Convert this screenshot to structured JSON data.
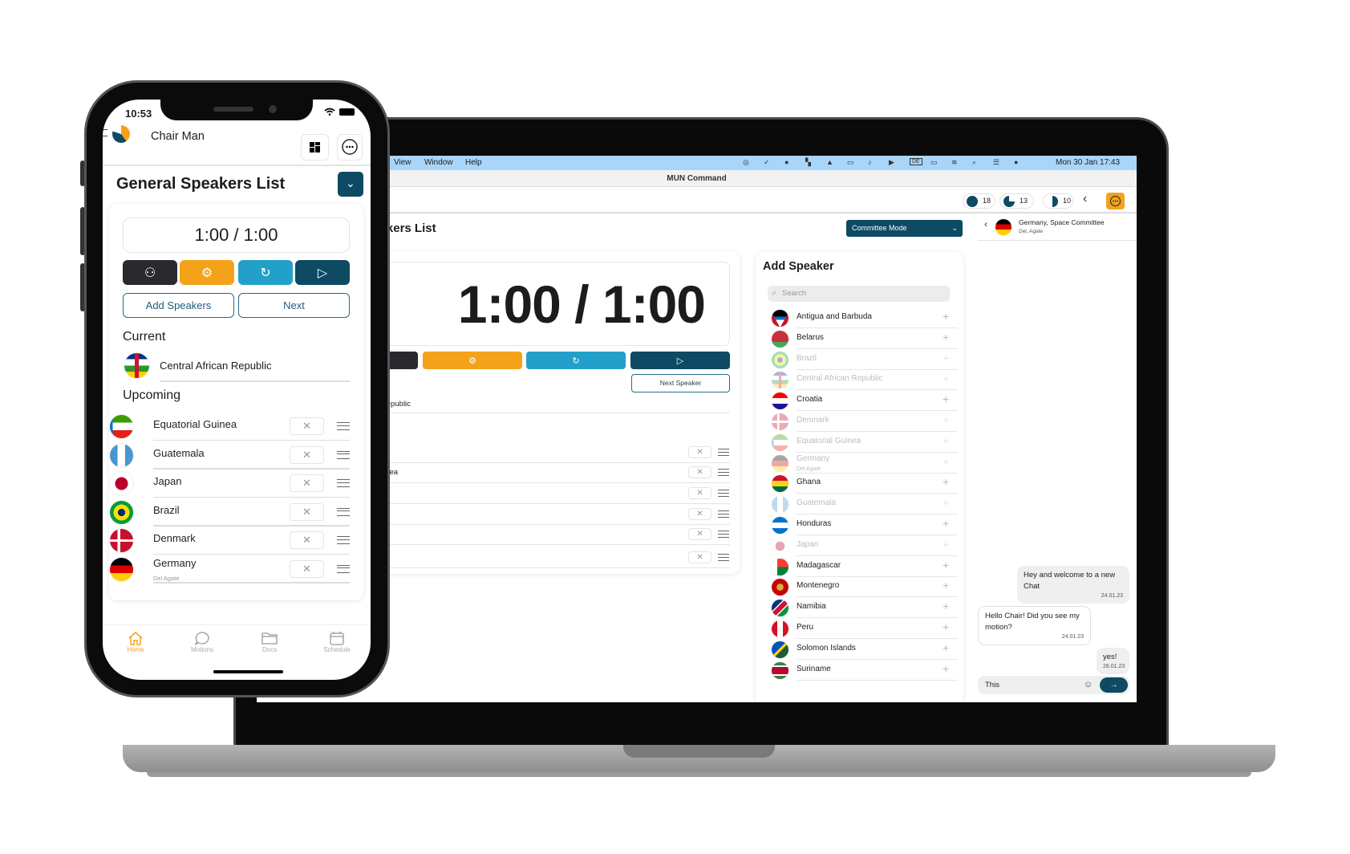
{
  "laptop": {
    "menubar": {
      "items": [
        "View",
        "Window",
        "Help"
      ],
      "clock": "Mon 30 Jan 17:43",
      "status_icons": [
        "creative-cloud-icon",
        "check-circle-icon",
        "arrow-circle-icon",
        "grid-icon",
        "drive-icon",
        "display-icon",
        "airpods-icon",
        "play-circle-icon",
        "keyboard-de-icon",
        "battery-icon",
        "wifi-icon",
        "search-icon",
        "control-center-icon",
        "siri-icon"
      ],
      "keyboard_label": "DE"
    },
    "window_title": "MUN Command",
    "toolbar": {
      "counters": [
        {
          "value": "18",
          "fill": "full"
        },
        {
          "value": "13",
          "fill": "three-quarter"
        },
        {
          "value": "10",
          "fill": "half"
        }
      ]
    },
    "page_title": "General Speakers List",
    "mode_select": "Committee Mode",
    "timer": "1:00 / 1:00",
    "next_speaker_label": "Next Speaker",
    "current_speaker": "Central African Republic",
    "upcoming": [
      {
        "name": ""
      },
      {
        "name": "Equatorial Guinea"
      },
      {
        "name": ""
      },
      {
        "name": ""
      },
      {
        "name": ""
      },
      {
        "name": ""
      }
    ],
    "add_speaker": {
      "title": "Add Speaker",
      "search_placeholder": "Search",
      "countries": [
        {
          "name": "Antigua and Barbuda",
          "added": false
        },
        {
          "name": "Belarus",
          "added": false
        },
        {
          "name": "Brazil",
          "added": true
        },
        {
          "name": "Central African Republic",
          "added": true
        },
        {
          "name": "Croatia",
          "added": false
        },
        {
          "name": "Denmark",
          "added": true
        },
        {
          "name": "Equatorial Guinea",
          "added": true
        },
        {
          "name": "Germany",
          "sub": "Del Agate",
          "added": true
        },
        {
          "name": "Ghana",
          "added": false
        },
        {
          "name": "Guatemala",
          "added": true
        },
        {
          "name": "Honduras",
          "added": false
        },
        {
          "name": "Japan",
          "added": true
        },
        {
          "name": "Madagascar",
          "added": false
        },
        {
          "name": "Montenegro",
          "added": false
        },
        {
          "name": "Namibia",
          "added": false
        },
        {
          "name": "Peru",
          "added": false
        },
        {
          "name": "Solomon Islands",
          "added": false
        },
        {
          "name": "Suriname",
          "added": false
        }
      ]
    },
    "chat": {
      "title": "Germany, Space Committee",
      "subtitle": "Del, Agate",
      "messages": [
        {
          "text": "Hey and welcome to a new Chat",
          "time": "24.01.23",
          "own": true
        },
        {
          "text": "Hello Chair! Did you see my motion?",
          "time": "24.01.23",
          "own": false
        },
        {
          "text": "yes!",
          "time": "28.01.23",
          "own": true
        }
      ],
      "input_value": "This"
    }
  },
  "phone": {
    "status_time": "10:53",
    "user_name": "Chair Man",
    "page_title": "General Speakers List",
    "timer": "1:00 / 1:00",
    "add_speakers_label": "Add Speakers",
    "next_label": "Next",
    "current_heading": "Current",
    "current_speaker": "Central African Republic",
    "upcoming_heading": "Upcoming",
    "upcoming": [
      {
        "name": "Equatorial Guinea"
      },
      {
        "name": "Guatemala"
      },
      {
        "name": "Japan"
      },
      {
        "name": "Brazil"
      },
      {
        "name": "Denmark"
      },
      {
        "name": "Germany",
        "sub": "Del Agate"
      }
    ],
    "tabs": [
      {
        "label": "Home",
        "active": true
      },
      {
        "label": "Motions"
      },
      {
        "label": "Docs"
      },
      {
        "label": "Schedule"
      }
    ]
  },
  "colors": {
    "primary": "#0e4a63",
    "accent": "#f5a21b",
    "info": "#23a0c9",
    "dark": "#2a2a2e",
    "menubar": "#a9d5f8"
  }
}
